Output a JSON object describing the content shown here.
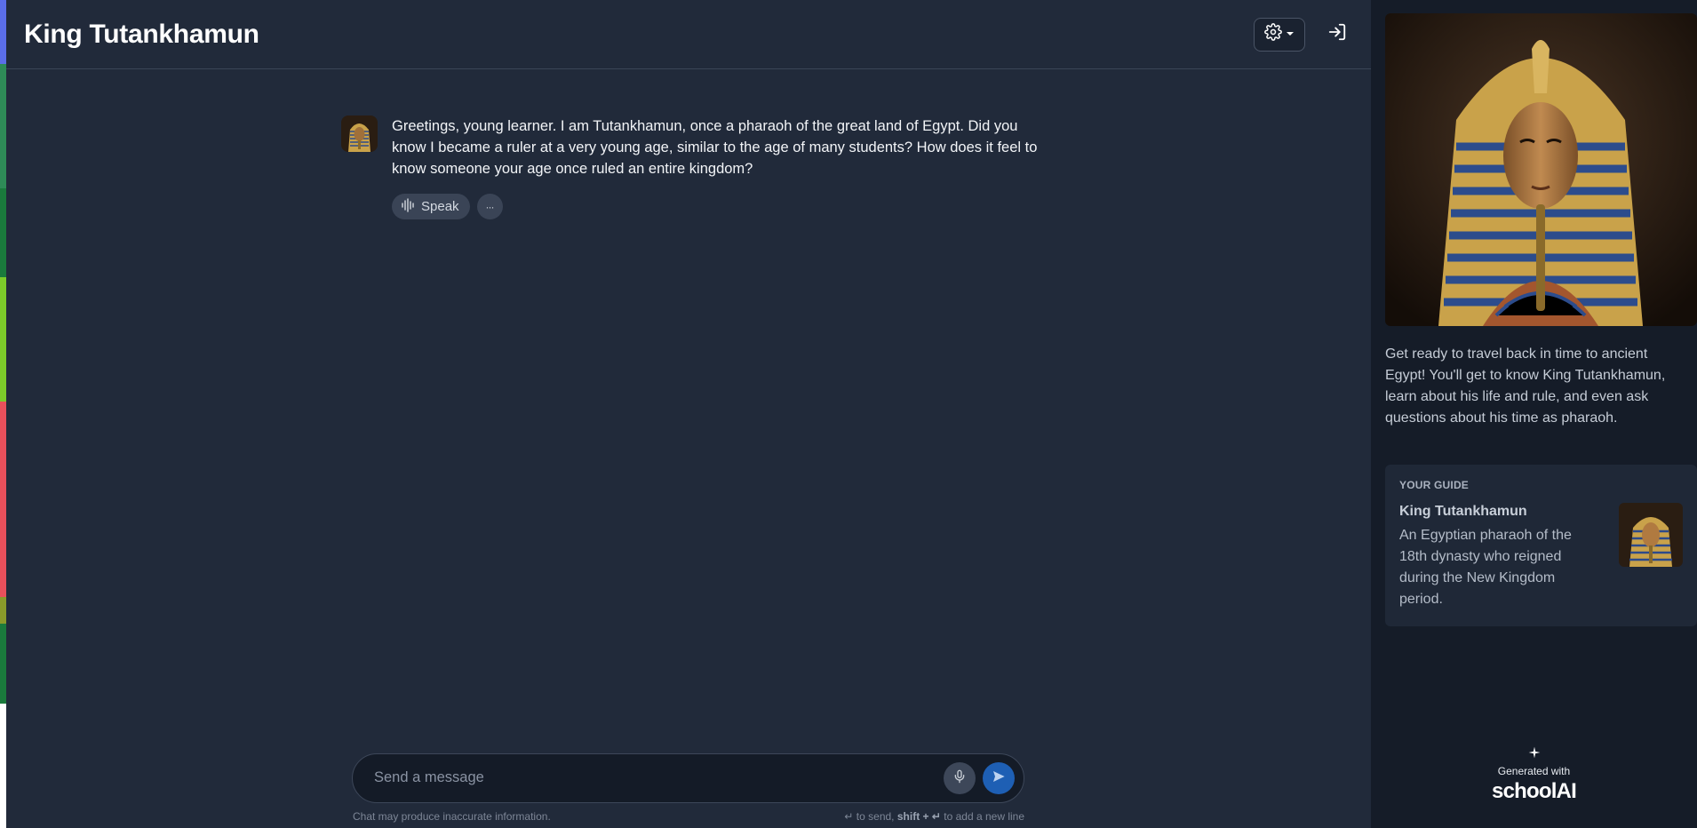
{
  "header": {
    "title": "King Tutankhamun"
  },
  "message": {
    "text": "Greetings, young learner. I am Tutankhamun, once a pharaoh of the great land of Egypt. Did you know I became a ruler at a very young age, similar to the age of many students? How does it feel to know someone your age once ruled an entire kingdom?",
    "speak_label": "Speak",
    "more_label": "···"
  },
  "composer": {
    "placeholder": "Send a message",
    "disclaimer": "Chat may produce inaccurate information.",
    "hint_prefix": "↵ to send,",
    "hint_bold": "shift + ↵",
    "hint_suffix": "to add a new line"
  },
  "sidebar": {
    "intro": "Get ready to travel back in time to ancient Egypt! You'll get to know King Tutankhamun, learn about his life and rule, and even ask questions about his time as pharaoh.",
    "guide_label": "YOUR GUIDE",
    "guide_name": "King Tutankhamun",
    "guide_desc": "An Egyptian pharaoh of the 18th dynasty who reigned during the New Kingdom period.",
    "generated_with": "Generated with",
    "brand": "schoolAI"
  },
  "colors": {
    "background": "#212a3a",
    "sidebar": "#151c28",
    "send_button": "#1e5fb4",
    "accent_gold": "#c9a24a"
  },
  "icons": {
    "settings": "gear-icon",
    "dropdown": "caret-down-icon",
    "login": "login-icon",
    "speak": "waveform-icon",
    "mic": "microphone-icon",
    "send": "send-icon",
    "sparkle": "sparkle-icon"
  }
}
